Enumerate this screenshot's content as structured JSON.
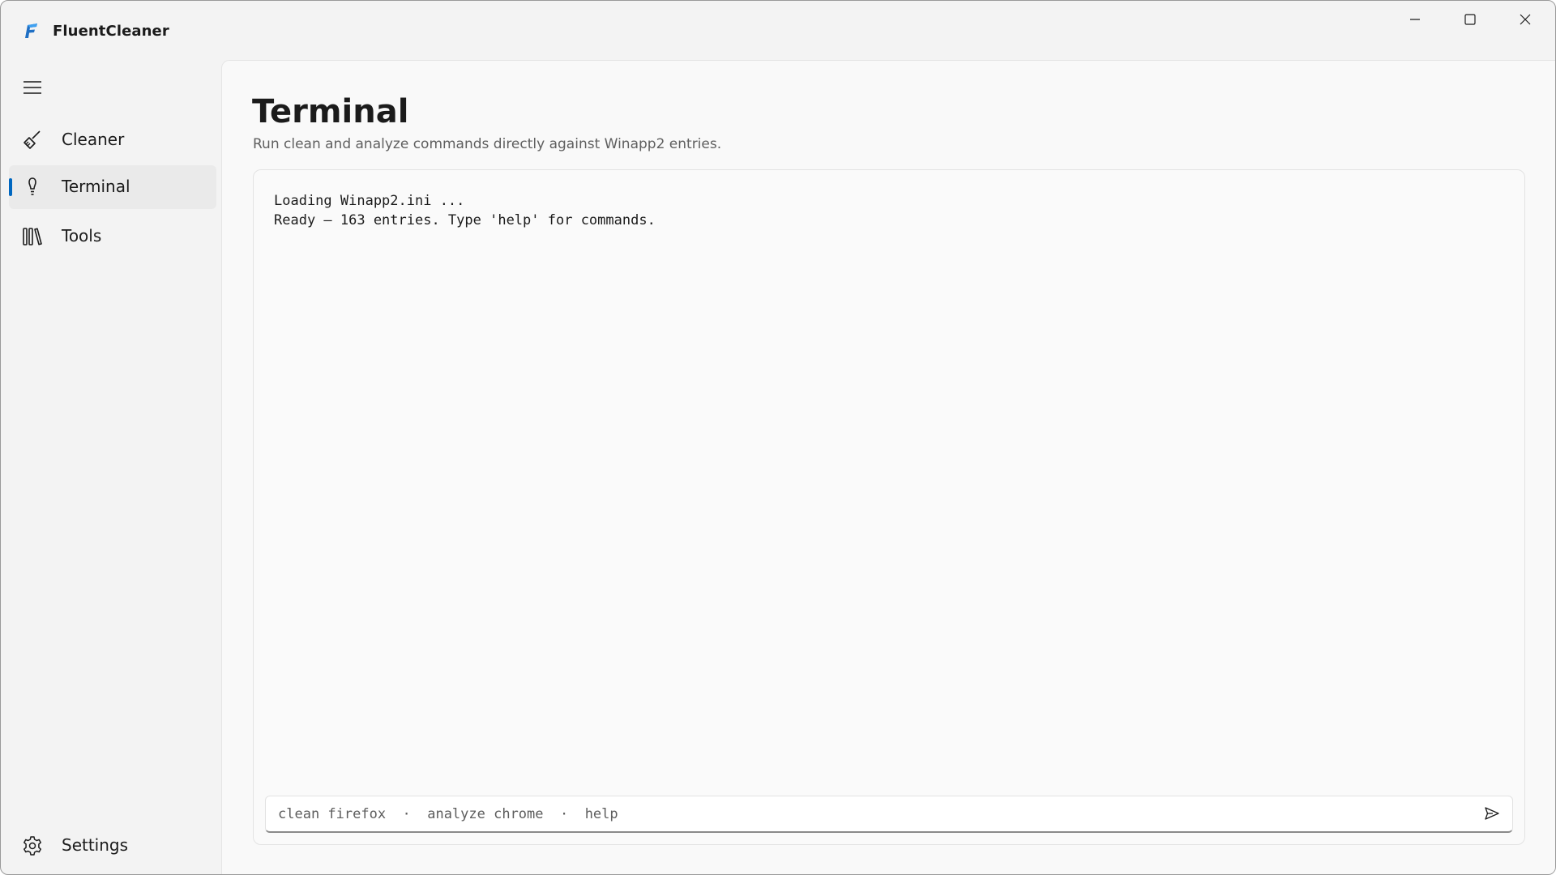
{
  "app": {
    "title": "FluentCleaner",
    "logo_icon": "fluentcleaner-logo-icon",
    "accent_color": "#0067c0"
  },
  "window_controls": {
    "minimize_icon": "minimize-icon",
    "maximize_icon": "maximize-icon",
    "close_icon": "close-icon"
  },
  "nav": {
    "menu_icon": "hamburger-menu-icon",
    "items": [
      {
        "label": "Cleaner",
        "icon": "broom-icon",
        "selected": false
      },
      {
        "label": "Terminal",
        "icon": "lightbulb-icon",
        "selected": true
      },
      {
        "label": "Tools",
        "icon": "library-icon",
        "selected": false
      }
    ],
    "footer_items": [
      {
        "label": "Settings",
        "icon": "gear-icon"
      }
    ]
  },
  "page": {
    "title": "Terminal",
    "subtitle": "Run clean and analyze commands directly against Winapp2 entries."
  },
  "terminal": {
    "output_lines": [
      "Loading Winapp2.ini ...",
      "Ready — 163 entries. Type 'help' for commands."
    ],
    "input": {
      "value": "",
      "placeholder": "clean firefox  ·  analyze chrome  ·  help"
    },
    "send_icon": "send-icon"
  }
}
